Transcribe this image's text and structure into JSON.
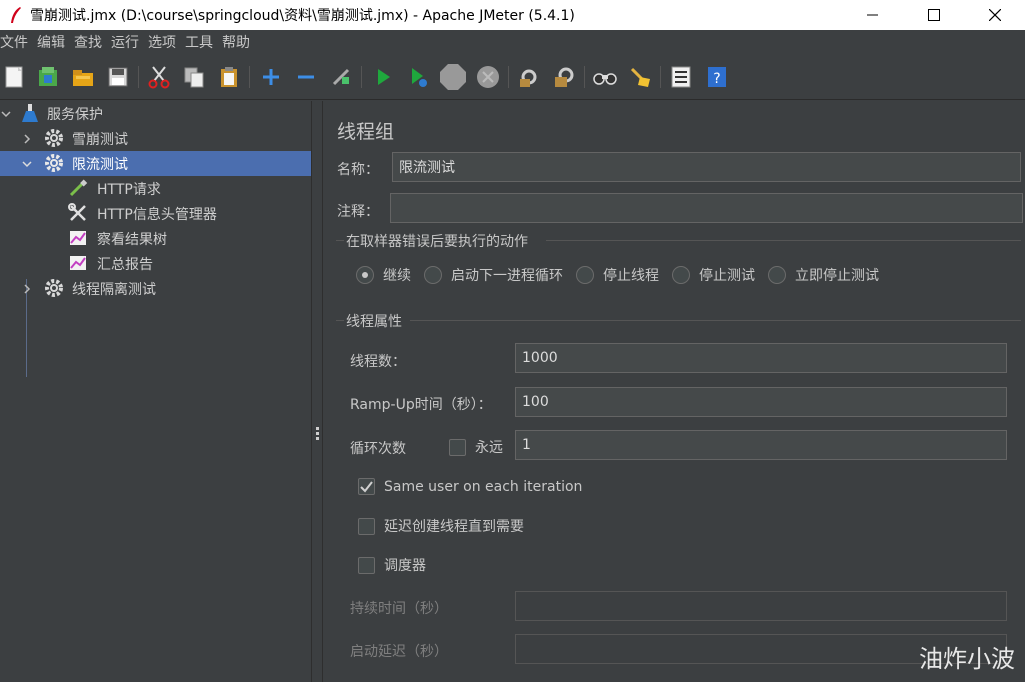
{
  "window": {
    "title": "雪崩测试.jmx (D:\\course\\springcloud\\资料\\雪崩测试.jmx) - Apache JMeter (5.4.1)",
    "controls": [
      "minimize-icon",
      "maximize-icon",
      "close-icon"
    ]
  },
  "menu": {
    "items": [
      "文件",
      "编辑",
      "查找",
      "运行",
      "选项",
      "工具",
      "帮助"
    ]
  },
  "toolbar": {
    "icons": [
      "new-icon",
      "templates-icon",
      "open-icon",
      "save-icon",
      "cut-icon",
      "copy-icon",
      "paste-icon",
      "expand-icon",
      "collapse-icon",
      "toggle-icon",
      "start-icon",
      "start-no-pause-icon",
      "stop-icon",
      "shutdown-icon",
      "clear-icon",
      "clear-all-icon",
      "search-icon",
      "reset-search-icon",
      "function-helper-icon",
      "help-icon"
    ]
  },
  "tree": {
    "root": "服务保护",
    "items": [
      {
        "label": "雪崩测试",
        "type": "thread-group",
        "expanded": false
      },
      {
        "label": "限流测试",
        "type": "thread-group",
        "expanded": true,
        "selected": true
      },
      {
        "label": "HTTP请求",
        "type": "sampler"
      },
      {
        "label": "HTTP信息头管理器",
        "type": "config"
      },
      {
        "label": "察看结果树",
        "type": "listener"
      },
      {
        "label": "汇总报告",
        "type": "listener"
      },
      {
        "label": "线程隔离测试",
        "type": "thread-group",
        "expanded": false
      }
    ]
  },
  "panel": {
    "heading": "线程组",
    "name_label": "名称：",
    "name_value": "限流测试",
    "comment_label": "注释：",
    "comment_value": "",
    "error_section": "在取样器错误后要执行的动作",
    "error_actions": [
      {
        "label": "继续",
        "selected": true
      },
      {
        "label": "启动下一进程循环",
        "selected": false
      },
      {
        "label": "停止线程",
        "selected": false
      },
      {
        "label": "停止测试",
        "selected": false
      },
      {
        "label": "立即停止测试",
        "selected": false
      }
    ],
    "thread_section": "线程属性",
    "threads_label": "线程数：",
    "threads_value": "1000",
    "rampup_label": "Ramp-Up时间（秒）：",
    "rampup_value": "100",
    "loop_label": "循环次数",
    "forever_label": "永远",
    "forever_checked": false,
    "loop_value": "1",
    "same_user_label": "Same user on each iteration",
    "same_user_checked": true,
    "delay_label": "延迟创建线程直到需要",
    "delay_checked": false,
    "scheduler_label": "调度器",
    "scheduler_checked": false,
    "duration_label": "持续时间（秒）",
    "duration_value": "",
    "startup_label": "启动延迟（秒）",
    "startup_value": ""
  },
  "watermark": "油炸小波"
}
